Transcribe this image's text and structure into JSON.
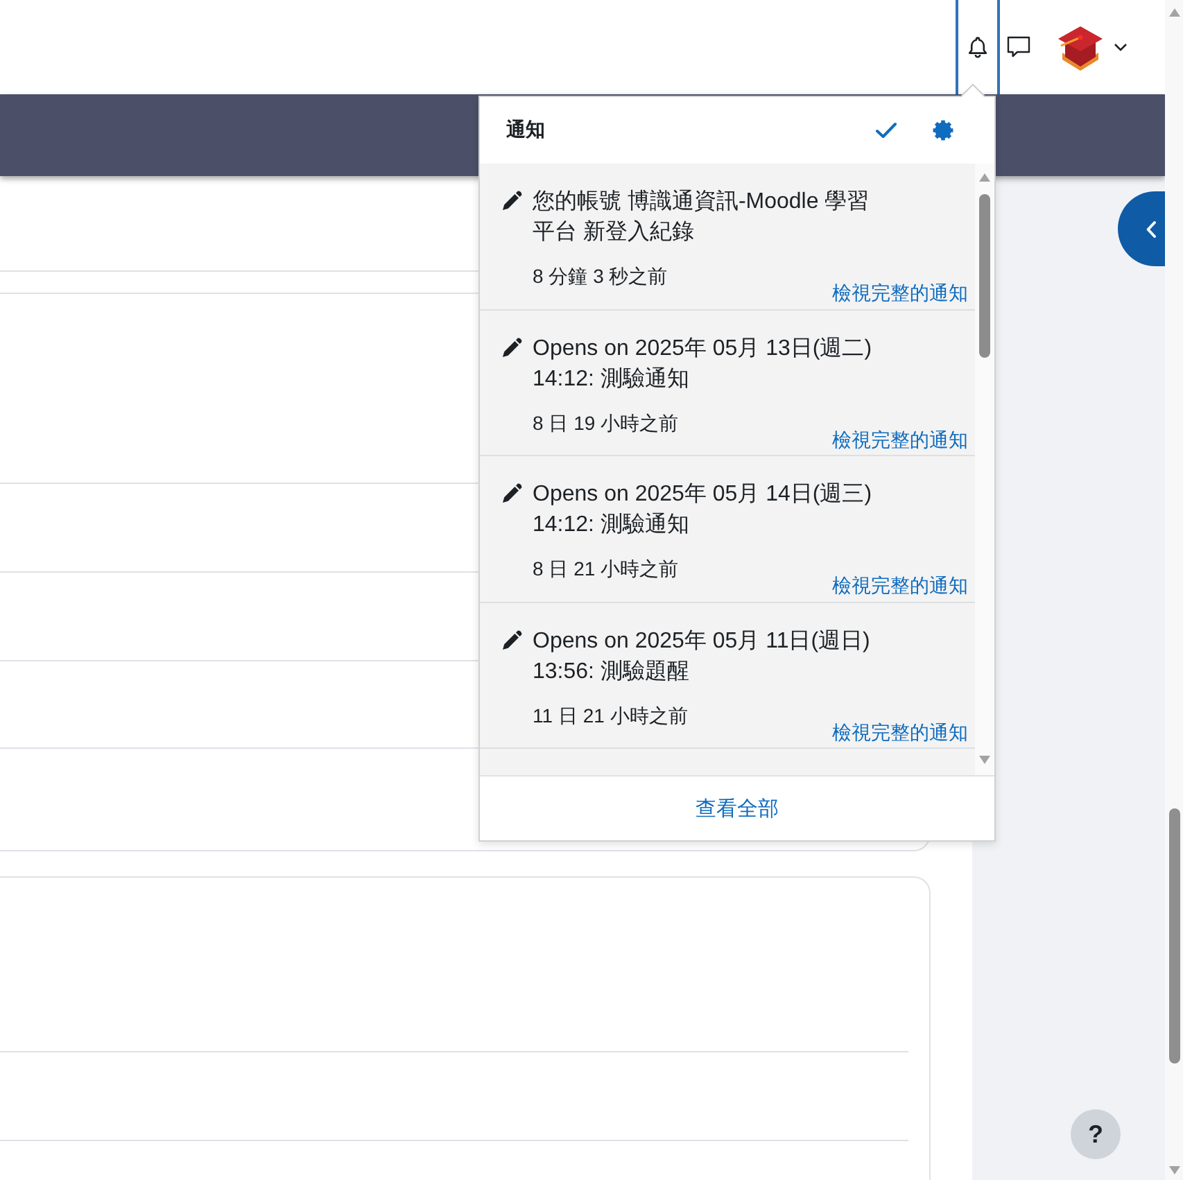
{
  "navbar": {
    "notifications_button": {
      "expanded": true
    }
  },
  "notifications": {
    "title": "通知",
    "items": [
      {
        "title": "您的帳號 博識通資訊-Moodle 學習平台 新登入紀錄",
        "time": "8 分鐘 3 秒之前",
        "link": "檢視完整的通知",
        "unread": true
      },
      {
        "title": "Opens on 2025年 05月 13日(週二) 14:12: 測驗通知",
        "time": "8 日 19 小時之前",
        "link": "檢視完整的通知",
        "unread": true
      },
      {
        "title": "Opens on 2025年 05月 14日(週三) 14:12: 測驗通知",
        "time": "8 日 21 小時之前",
        "link": "檢視完整的通知",
        "unread": true
      },
      {
        "title": "Opens on 2025年 05月 11日(週日) 13:56: 測驗題醒",
        "time": "11 日 21 小時之前",
        "link": "檢視完整的通知",
        "unread": true
      }
    ],
    "view_all": "查看全部"
  },
  "help_button": {
    "label": "?"
  }
}
